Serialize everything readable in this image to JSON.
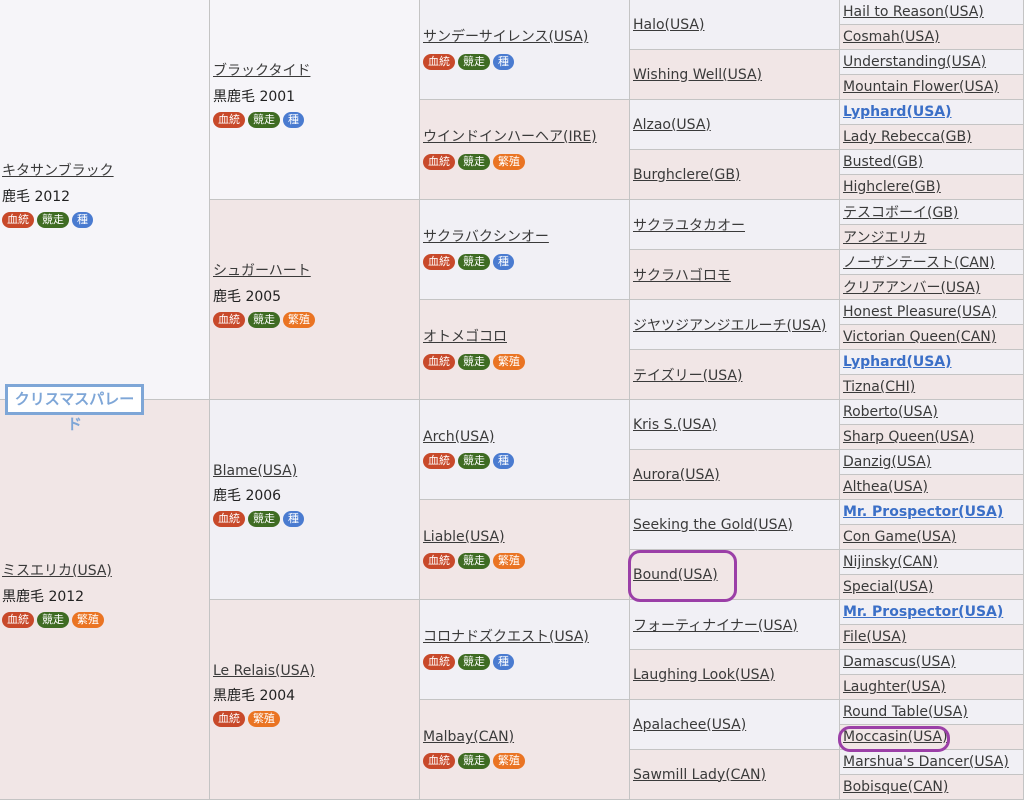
{
  "subject": "クリスマスパレード",
  "badge_labels": {
    "blood": "血統",
    "race": "競走",
    "stud": "種",
    "breed": "繁殖"
  },
  "gen1": [
    {
      "name": "キタサンブラック",
      "meta": "鹿毛 2012",
      "badges": [
        "blood",
        "race",
        "stud"
      ]
    },
    {
      "name": "ミスエリカ(USA)",
      "meta": "黒鹿毛 2012",
      "badges": [
        "blood",
        "race",
        "breed"
      ]
    }
  ],
  "gen2": [
    {
      "name": "ブラックタイド",
      "meta": "黒鹿毛 2001",
      "badges": [
        "blood",
        "race",
        "stud"
      ]
    },
    {
      "name": "シュガーハート",
      "meta": "鹿毛 2005",
      "badges": [
        "blood",
        "race",
        "breed"
      ]
    },
    {
      "name": "Blame(USA)",
      "meta": "鹿毛 2006",
      "badges": [
        "blood",
        "race",
        "stud"
      ]
    },
    {
      "name": "Le Relais(USA)",
      "meta": "黒鹿毛 2004",
      "badges": [
        "blood",
        "breed"
      ]
    }
  ],
  "gen3": [
    {
      "name": "サンデーサイレンス(USA)",
      "badges": [
        "blood",
        "race",
        "stud"
      ]
    },
    {
      "name": "ウインドインハーヘア(IRE)",
      "badges": [
        "blood",
        "race",
        "breed"
      ]
    },
    {
      "name": "サクラバクシンオー",
      "badges": [
        "blood",
        "race",
        "stud"
      ]
    },
    {
      "name": "オトメゴコロ",
      "badges": [
        "blood",
        "race",
        "breed"
      ]
    },
    {
      "name": "Arch(USA)",
      "badges": [
        "blood",
        "race",
        "stud"
      ]
    },
    {
      "name": "Liable(USA)",
      "badges": [
        "blood",
        "race",
        "breed"
      ]
    },
    {
      "name": "コロナドズクエスト(USA)",
      "badges": [
        "blood",
        "race",
        "stud"
      ]
    },
    {
      "name": "Malbay(CAN)",
      "badges": [
        "blood",
        "race",
        "breed"
      ]
    }
  ],
  "gen4": [
    {
      "name": "Halo(USA)"
    },
    {
      "name": "Wishing Well(USA)"
    },
    {
      "name": "Alzao(USA)"
    },
    {
      "name": "Burghclere(GB)"
    },
    {
      "name": "サクラユタカオー"
    },
    {
      "name": "サクラハゴロモ"
    },
    {
      "name": "ジヤツジアンジエルーチ(USA)"
    },
    {
      "name": "テイズリー(USA)"
    },
    {
      "name": "Kris S.(USA)"
    },
    {
      "name": "Aurora(USA)"
    },
    {
      "name": "Seeking the Gold(USA)"
    },
    {
      "name": "Bound(USA)"
    },
    {
      "name": "フォーティナイナー(USA)"
    },
    {
      "name": "Laughing Look(USA)"
    },
    {
      "name": "Apalachee(USA)"
    },
    {
      "name": "Sawmill Lady(CAN)"
    }
  ],
  "gen5": [
    {
      "name": "Hail to Reason(USA)"
    },
    {
      "name": "Cosmah(USA)"
    },
    {
      "name": "Understanding(USA)"
    },
    {
      "name": "Mountain Flower(USA)"
    },
    {
      "name": "Lyphard(USA)",
      "bold": true
    },
    {
      "name": "Lady Rebecca(GB)"
    },
    {
      "name": "Busted(GB)"
    },
    {
      "name": "Highclere(GB)"
    },
    {
      "name": "テスコボーイ(GB)"
    },
    {
      "name": "アンジエリカ"
    },
    {
      "name": "ノーザンテースト(CAN)"
    },
    {
      "name": "クリアアンバー(USA)"
    },
    {
      "name": "Honest Pleasure(USA)"
    },
    {
      "name": "Victorian Queen(CAN)"
    },
    {
      "name": "Lyphard(USA)",
      "bold": true
    },
    {
      "name": "Tizna(CHI)"
    },
    {
      "name": "Roberto(USA)"
    },
    {
      "name": "Sharp Queen(USA)"
    },
    {
      "name": "Danzig(USA)"
    },
    {
      "name": "Althea(USA)"
    },
    {
      "name": "Mr. Prospector(USA)",
      "bold": true
    },
    {
      "name": "Con Game(USA)"
    },
    {
      "name": "Nijinsky(CAN)"
    },
    {
      "name": "Special(USA)"
    },
    {
      "name": "Mr. Prospector(USA)",
      "bold": true
    },
    {
      "name": "File(USA)"
    },
    {
      "name": "Damascus(USA)"
    },
    {
      "name": "Laughter(USA)"
    },
    {
      "name": "Round Table(USA)"
    },
    {
      "name": "Moccasin(USA)"
    },
    {
      "name": "Marshua's Dancer(USA)"
    },
    {
      "name": "Bobisque(CAN)"
    }
  ],
  "highlights": [
    "Bound(USA)",
    "Moccasin(USA)"
  ],
  "colors": {
    "blood": "#c8492a",
    "race": "#3f6c23",
    "stud": "#4a7bd0",
    "breed": "#ea7423",
    "highlight": "#9b3fa7",
    "link_bold": "#3b6fc7"
  }
}
